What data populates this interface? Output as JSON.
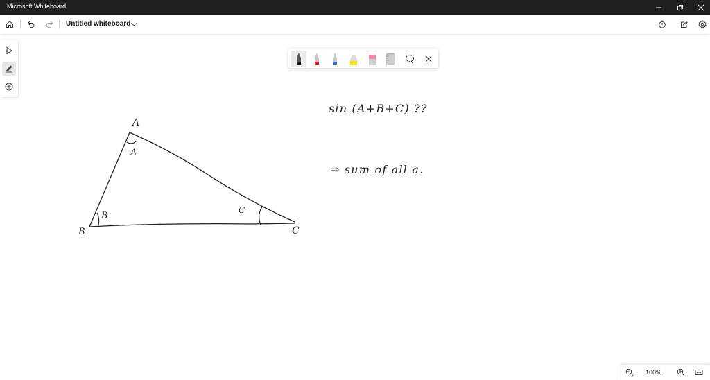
{
  "window": {
    "title": "Microsoft Whiteboard"
  },
  "header": {
    "doc_title": "Untitled whiteboard"
  },
  "zoom": {
    "level": "100%"
  },
  "pens": [
    {
      "name": "black-marker",
      "color": "#1a1a1a"
    },
    {
      "name": "red-marker",
      "color": "#d41c2c"
    },
    {
      "name": "blue-marker",
      "color": "#3a6fb5"
    },
    {
      "name": "yellow-highlighter",
      "color": "#f2e600"
    },
    {
      "name": "pink-eraser",
      "color": "#f08aa0"
    },
    {
      "name": "ruler",
      "color": "#bdbdbd"
    }
  ],
  "ink": {
    "vertex_a": "A",
    "angle_a": "A",
    "vertex_b": "B",
    "angle_b": "B",
    "vertex_c": "C",
    "angle_c": "C",
    "note_line1": "sin (A+B+C) ??",
    "note_line2": "⇒ sum of all a."
  }
}
